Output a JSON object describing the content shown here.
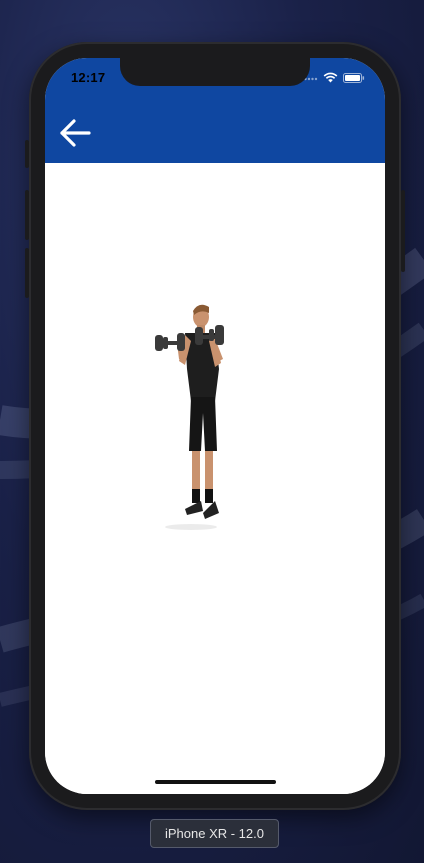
{
  "status_bar": {
    "time": "12:17",
    "icons": [
      "signal-dots-icon",
      "wifi-icon",
      "battery-icon"
    ]
  },
  "app_bar": {
    "back_icon": "arrow-back-icon",
    "background_color": "#0f47a1"
  },
  "content": {
    "image": "man-doing-dumbbell-curl-illustration"
  },
  "simulator": {
    "device_label": "iPhone XR - 12.0"
  }
}
